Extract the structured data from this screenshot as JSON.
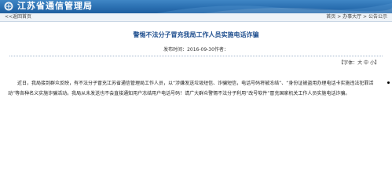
{
  "header": {
    "site_title": "江苏省通信管理局"
  },
  "nav": {
    "back_label": "<<返回首页",
    "breadcrumb": [
      "首页",
      "办事大厅",
      "公告公示"
    ],
    "separator": " > "
  },
  "article": {
    "title": "警惕不法分子冒充我局工作人员实施电话诈骗",
    "meta": "发布时间：2016-09-30作者：",
    "font_size_prefix": "【字体：",
    "font_size_options": [
      "大",
      "中",
      "小"
    ],
    "font_size_suffix": "】",
    "body": "近日，我局接到群众反映，有不法分子冒充江苏省通信管理局工作人员，以“涉嫌发送垃圾短信、诈骗短信，电话号码将被冻结”、“身份证被盗用办理电话卡实施违法犯罪活动”等各种名义实施诈骗活动。我局从未发送也不会直接通知用户冻结用户电话号码！请广大群众警惕不法分子利用“改号软件”冒充国家机关工作人员实施电话诈骗。"
  },
  "colors": {
    "banner": "#2a6fb1",
    "title": "#1f4f8f"
  }
}
